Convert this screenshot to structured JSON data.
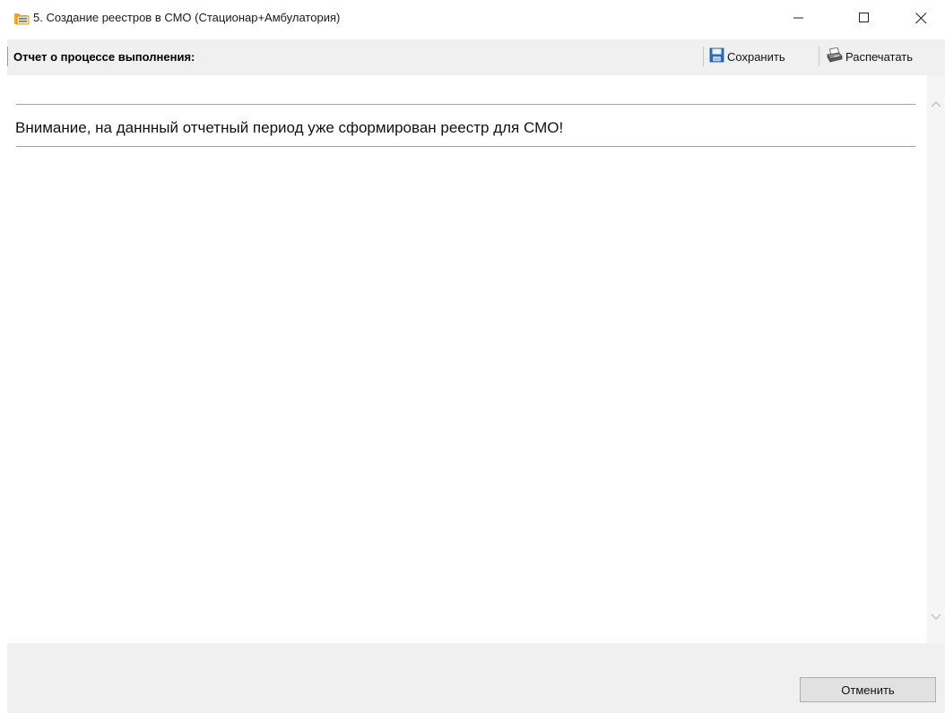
{
  "window": {
    "title": "5. Создание реестров в СМО  (Стационар+Амбулатория)",
    "icon": "folder-app-icon",
    "controls": [
      "minimize",
      "maximize",
      "close"
    ]
  },
  "toolbar": {
    "title": "Отчет о процессе выполнения:",
    "save_label": "Сохранить",
    "save_icon": "floppy-disk-icon",
    "print_label": "Распечатать",
    "print_icon": "printer-icon"
  },
  "report": {
    "message": "Внимание, на даннный отчетный период уже сформирован реестр для СМО!"
  },
  "footer": {
    "cancel_label": "Отменить"
  },
  "colors": {
    "toolbar_bg": "#f0f0f0",
    "footer_bg": "#f0f0f0",
    "content_bg": "#ffffff",
    "save_icon_blue": "#2f6fb7",
    "folder_orange": "#f5a623"
  }
}
